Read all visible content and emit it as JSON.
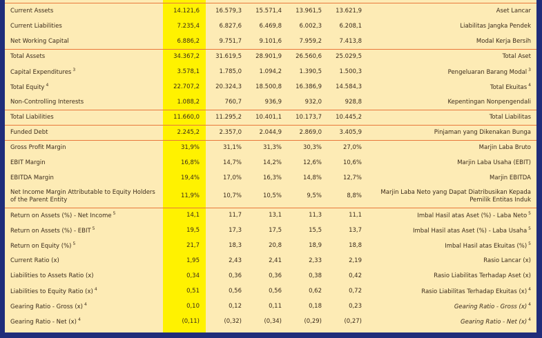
{
  "rows": [
    {
      "en": "Current Assets",
      "id": "Aset Lancar",
      "v": [
        "14.121,6",
        "16.579,3",
        "15.571,4",
        "13.961,5",
        "13.621,9"
      ],
      "sup": ""
    },
    {
      "en": "Current Liabilities",
      "id": "Liabilitas Jangka Pendek",
      "v": [
        "7.235,4",
        "6.827,6",
        "6.469,8",
        "6.002,3",
        "6.208,1"
      ],
      "sup": ""
    },
    {
      "en": "Net Working Capital",
      "id": "Modal Kerja Bersih",
      "v": [
        "6.886,2",
        "9.751,7",
        "9.101,6",
        "7.959,2",
        "7.413,8"
      ],
      "sup": ""
    },
    {
      "en": "Total Assets",
      "id": "Total Aset",
      "v": [
        "34.367,2",
        "31.619,5",
        "28.901,9",
        "26.560,6",
        "25.029,5"
      ],
      "sup": ""
    },
    {
      "en": "Capital Expenditures",
      "id": "Pengeluaran Barang Modal",
      "v": [
        "3.578,1",
        "1.785,0",
        "1.094,2",
        "1.390,5",
        "1.500,3"
      ],
      "sup": "3"
    },
    {
      "en": "Total Equity",
      "id": "Total Ekuitas",
      "v": [
        "22.707,2",
        "20.324,3",
        "18.500,8",
        "16.386,9",
        "14.584,3"
      ],
      "sup": "4"
    },
    {
      "en": "Non-Controlling Interests",
      "id": "Kepentingan Nonpengendali",
      "v": [
        "1.088,2",
        "760,7",
        "936,9",
        "932,0",
        "928,8"
      ],
      "sup": ""
    },
    {
      "en": "Total Liabilities",
      "id": "Total Liabilitas",
      "v": [
        "11.660,0",
        "11.295,2",
        "10.401,1",
        "10.173,7",
        "10.445,2"
      ],
      "sup": ""
    },
    {
      "en": "Funded Debt",
      "id": "Pinjaman yang Dikenakan Bunga",
      "v": [
        "2.245,2",
        "2.357,0",
        "2.044,9",
        "2.869,0",
        "3.405,9"
      ],
      "sup": ""
    },
    {
      "en": "Gross Profit Margin",
      "id": "Marjin Laba Bruto",
      "v": [
        "31,9%",
        "31,1%",
        "31,3%",
        "30,3%",
        "27,0%"
      ],
      "sup": ""
    },
    {
      "en": "EBIT Margin",
      "id": "Marjin Laba Usaha (EBIT)",
      "v": [
        "16,8%",
        "14,7%",
        "14,2%",
        "12,6%",
        "10,6%"
      ],
      "sup": ""
    },
    {
      "en": "EBITDA Margin",
      "id": "Marjin EBITDA",
      "v": [
        "19,4%",
        "17,0%",
        "16,3%",
        "14,8%",
        "12,7%"
      ],
      "sup": ""
    },
    {
      "en": "Net Income Margin Attributable to Equity Holders of the Parent Entity",
      "id": "Marjin Laba Neto yang Dapat Diatribusikan Kepada Pemilik Entitas Induk",
      "v": [
        "11,9%",
        "10,7%",
        "10,5%",
        "9,5%",
        "8,8%"
      ],
      "sup": ""
    },
    {
      "en": "Return on Assets (%) - Net Income",
      "id": "Imbal Hasil atas Aset (%) - Laba Neto",
      "v": [
        "14,1",
        "11,7",
        "13,1",
        "11,3",
        "11,1"
      ],
      "sup": "5"
    },
    {
      "en": "Return on Assets (%) - EBIT",
      "id": "Imbal Hasil atas Aset (%) - Laba Usaha",
      "v": [
        "19,5",
        "17,3",
        "17,5",
        "15,5",
        "13,7"
      ],
      "sup": "5"
    },
    {
      "en": "Return on Equity (%)",
      "id": "Imbal Hasil atas Ekuitas (%)",
      "v": [
        "21,7",
        "18,3",
        "20,8",
        "18,9",
        "18,8"
      ],
      "sup": "5"
    },
    {
      "en": "Current Ratio (x)",
      "id": "Rasio Lancar (x)",
      "v": [
        "1,95",
        "2,43",
        "2,41",
        "2,33",
        "2,19"
      ],
      "sup": ""
    },
    {
      "en": "Liabilities to Assets Ratio (x)",
      "id": "Rasio Liabilitas Terhadap Aset (x)",
      "v": [
        "0,34",
        "0,36",
        "0,36",
        "0,38",
        "0,42"
      ],
      "sup": ""
    },
    {
      "en": "Liabilities to Equity Ratio (x)",
      "id": "Rasio Liabilitas Terhadap Ekuitas (x)",
      "v": [
        "0,51",
        "0,56",
        "0,56",
        "0,62",
        "0,72"
      ],
      "sup": "4"
    },
    {
      "en": "Gearing Ratio - Gross (x)",
      "id": "Gearing Ratio - Gross (x)",
      "v": [
        "0,10",
        "0,12",
        "0,11",
        "0,18",
        "0,23"
      ],
      "sup": "4",
      "italic": true
    },
    {
      "en": "Gearing Ratio - Net (x)",
      "id": "Gearing Ratio - Net (x)",
      "v": [
        "(0,11)",
        "(0,32)",
        "(0,34)",
        "(0,29)",
        "(0,27)"
      ],
      "sup": "4",
      "italic": true
    }
  ],
  "colors": {
    "background": "#1f2d7a",
    "sheet": "#fdebb5",
    "highlight_column": "#fff200",
    "separator": "#e8773a",
    "text": "#3a2a1a"
  }
}
